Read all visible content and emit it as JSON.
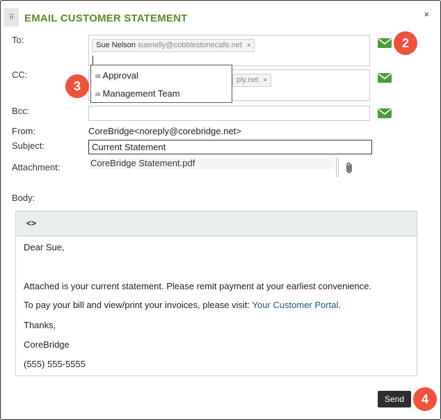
{
  "dialog": {
    "title": "EMAIL CUSTOMER STATEMENT",
    "close_label": "×",
    "handle_glyph": "⠿"
  },
  "to": {
    "label": "To:",
    "tag_name": "Sue Nelson",
    "tag_email": "suenelly@cobblestonecafe.net",
    "tag_remove": "×"
  },
  "cc": {
    "label": "CC:",
    "tag_partial": "ply.net",
    "tag_remove": "×"
  },
  "bcc": {
    "label": "Bcc:",
    "value": ""
  },
  "from": {
    "label": "From:",
    "value": "CoreBridge<noreply@corebridge.net>"
  },
  "subject": {
    "label": "Subject:",
    "value": "Current Statement"
  },
  "attachment": {
    "label": "Attachment:",
    "value": "CoreBridge Statement.pdf"
  },
  "body_label": "Body:",
  "dropdown": {
    "items": [
      {
        "icon": "✉",
        "label": "Approval"
      },
      {
        "icon": "✉",
        "label": "Management Team"
      }
    ]
  },
  "editor": {
    "code_button": "<>",
    "greeting": "Dear Sue,",
    "line1": "Attached is your current statement. Please remit payment at your earliest convenience.",
    "line2_prefix": "To pay your bill and view/print your invoices, please visit: ",
    "line2_link": "Your Customer Portal",
    "line2_suffix": ".",
    "thanks": "Thanks,",
    "signature": "CoreBridge",
    "phone": "(555) 555-5555"
  },
  "send_label": "Send",
  "badges": {
    "b2": "2",
    "b3": "3",
    "b4": "4"
  },
  "colors": {
    "title_green": "#5b8a2e",
    "mail_green": "#4e9a3a",
    "badge_red": "#f0523d",
    "link_blue": "#1d4f8a"
  },
  "icons": {
    "mail": "envelope-icon",
    "attach": "paperclip-icon"
  }
}
